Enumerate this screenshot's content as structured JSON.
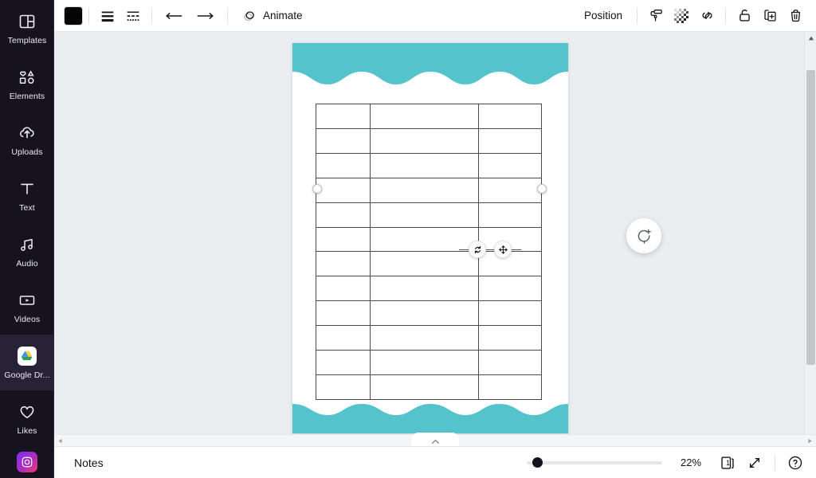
{
  "app": {
    "accent_teal": "#55c3cc",
    "sidebar_bg": "#16131f",
    "canvas_bg": "#eaeef1"
  },
  "sidebar": {
    "items": [
      {
        "label": "Templates",
        "icon": "templates-icon",
        "active": false
      },
      {
        "label": "Elements",
        "icon": "elements-icon",
        "active": false
      },
      {
        "label": "Uploads",
        "icon": "uploads-icon",
        "active": false
      },
      {
        "label": "Text",
        "icon": "text-icon",
        "active": false
      },
      {
        "label": "Audio",
        "icon": "audio-icon",
        "active": false
      },
      {
        "label": "Videos",
        "icon": "videos-icon",
        "active": false
      },
      {
        "label": "Google Dr...",
        "icon": "google-drive-icon",
        "active": true
      },
      {
        "label": "Likes",
        "icon": "heart-icon",
        "active": false
      }
    ]
  },
  "toolbar": {
    "color_swatch_value": "#050505",
    "color_swatch_name": "border-color",
    "border_weight_label": "border-weight",
    "border_style_label": "border-style",
    "line_start_label": "line-start",
    "line_end_label": "line-end",
    "animate_label": "Animate",
    "position_label": "Position",
    "paint_label": "paint-roller",
    "transparency_label": "transparency",
    "link_label": "link",
    "lock_label": "lock",
    "duplicate_label": "duplicate",
    "delete_label": "delete"
  },
  "canvas": {
    "page_number": "1",
    "table": {
      "columns": 3,
      "rows": 12,
      "column_widths_pct": [
        24,
        48,
        28
      ],
      "cells": [
        [
          "",
          "",
          ""
        ],
        [
          "",
          "",
          ""
        ],
        [
          "",
          "",
          ""
        ],
        [
          "",
          "",
          ""
        ],
        [
          "",
          "",
          ""
        ],
        [
          "",
          "",
          ""
        ],
        [
          "",
          "",
          ""
        ],
        [
          "",
          "",
          ""
        ],
        [
          "",
          "",
          ""
        ],
        [
          "",
          "",
          ""
        ],
        [
          "",
          "",
          ""
        ],
        [
          "",
          "",
          ""
        ]
      ],
      "border_color": "#4a4a4a"
    },
    "selection": {
      "rotate_label": "rotate",
      "move_label": "move"
    },
    "comment_fab_label": "add-comment"
  },
  "bottombar": {
    "notes_label": "Notes",
    "zoom_percent": "22%",
    "zoom_value": 22,
    "page_indicator": "1",
    "fullscreen_label": "fullscreen",
    "help_label": "help"
  }
}
